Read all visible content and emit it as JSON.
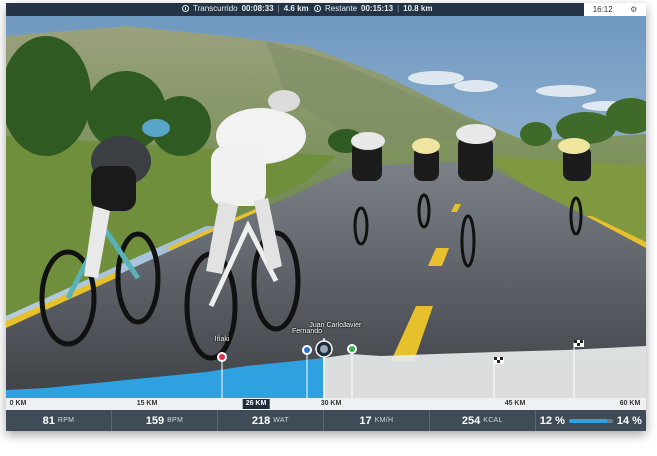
{
  "topbar": {
    "elapsed_label": "Transcurrido",
    "elapsed_time": "00:08:33",
    "elapsed_distance": "4.6 km",
    "remaining_label": "Restante",
    "remaining_time": "00:15:13",
    "remaining_distance": "10.8 km",
    "separator": "|"
  },
  "clock": {
    "time": "16:12",
    "settings_glyph": "⚙"
  },
  "riders": [
    {
      "name": "Iñaki"
    },
    {
      "name": "Fernando"
    },
    {
      "name": "Juan Carlos"
    },
    {
      "name": "Javier"
    }
  ],
  "route": {
    "km_labels": [
      "0 KM",
      "15 KM",
      "26 KM",
      "30 KM",
      "45 KM",
      "60 KM"
    ],
    "current_km": "26 KM",
    "progress_fraction": 0.5
  },
  "stats": {
    "cadence": {
      "value": "81",
      "unit": "RPM"
    },
    "heart_rate": {
      "value": "159",
      "unit": "BPM"
    },
    "power": {
      "value": "218",
      "unit": "WAT"
    },
    "speed": {
      "value": "17",
      "unit": "KM/H"
    },
    "calories": {
      "value": "254",
      "unit": "KCAL"
    },
    "grade_current": "12 %",
    "grade_target": "14 %",
    "grade_fraction": 0.86
  },
  "colors": {
    "topbar": "#253445",
    "progress_blue": "#2fa0e0",
    "stats_bar": "#3f4b57"
  },
  "icons": [
    "clock-icon",
    "gear-icon",
    "flag-icon",
    "rider-marker-icon"
  ]
}
